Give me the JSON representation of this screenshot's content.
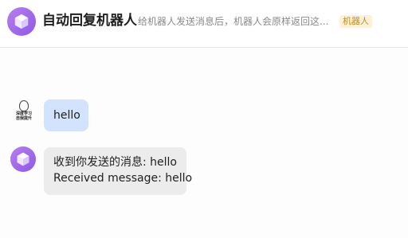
{
  "header": {
    "title": "自动回复机器人",
    "description": "给机器人发送消息后，机器人会原样返回这...",
    "tag": "机器人"
  },
  "user_avatar": {
    "caption_line1": "深度学习",
    "caption_line2": "自我提升"
  },
  "messages": [
    {
      "sender": "user",
      "text": "hello"
    },
    {
      "sender": "bot",
      "line1": "收到你发送的消息: hello",
      "line2": "Received message: hello"
    }
  ],
  "colors": {
    "bot_avatar": "#9b66ea",
    "user_bubble": "#d3e3fd",
    "bot_bubble": "#ececec",
    "tag_bg": "#fdf2d9",
    "tag_text": "#c58a1e"
  }
}
